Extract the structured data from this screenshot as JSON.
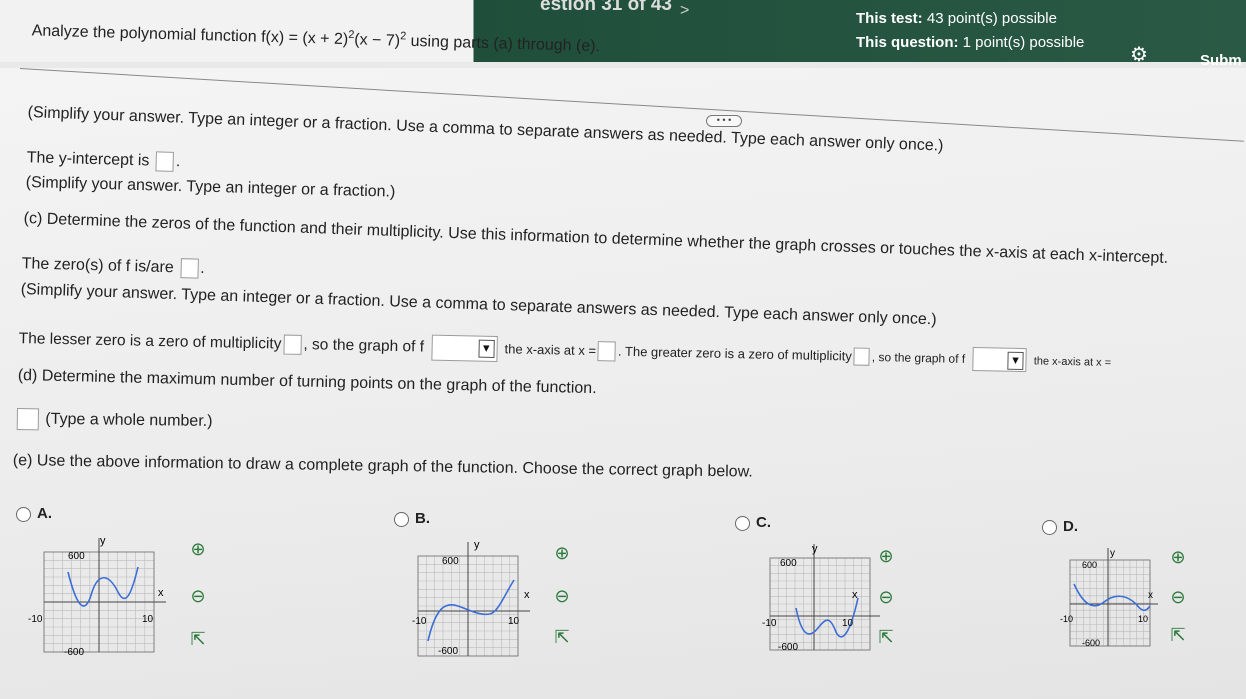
{
  "header": {
    "question_counter": "estion 31 of 43",
    "next_arrow": ">",
    "test_points_label": "This test:",
    "test_points_value": "43 point(s) possible",
    "question_points_label": "This question:",
    "question_points_value": "1 point(s) possible",
    "submit_label": "Subm"
  },
  "problem": {
    "prefix": "Analyze the polynomial function f(x) = (x + 2)",
    "exp1": "2",
    "mid": "(x − 7)",
    "exp2": "2",
    "suffix": " using parts (a) through (e)."
  },
  "more_button": "• • •",
  "lines": {
    "b_simplify": "(Simplify your answer. Type an integer or a fraction. Use a comma to separate answers as needed. Type each answer only once.)",
    "y_intercept_label": "The y-intercept is",
    "y_intercept_end": ".",
    "b_simplify2": "(Simplify your answer. Type an integer or a fraction.)",
    "c_prompt": "(c) Determine the zeros of the function and their multiplicity. Use this information to determine whether the graph crosses or touches the x-axis at each x-intercept.",
    "zeros_label": "The zero(s) of f is/are",
    "zeros_end": ".",
    "c_simplify": "(Simplify your answer. Type an integer or a fraction. Use a comma to separate answers as needed. Type each answer only once.)",
    "lesser_a": "The lesser zero is a zero of multiplicity",
    "lesser_b": ", so the graph of f",
    "lesser_c": "the x-axis at x =",
    "greater_a": ". The greater zero is a zero of multiplicity",
    "greater_b": ", so the graph of f",
    "greater_c": "the x-axis at x =",
    "d_prompt": "(d) Determine the maximum number of turning points on the graph of the function.",
    "d_hint": "(Type a whole number.)",
    "e_prompt": "(e) Use the above information to draw a complete graph of the function. Choose the correct graph below."
  },
  "options": [
    {
      "label": "A.",
      "ymax": "600",
      "ymin": "-600",
      "xmin": "-10",
      "xmax": "10",
      "xlab": "x",
      "ylab": "y"
    },
    {
      "label": "B.",
      "ymax": "600",
      "ymin": "-600",
      "xmin": "-10",
      "xmax": "10",
      "xlab": "x",
      "ylab": "y"
    },
    {
      "label": "C.",
      "ymax": "600",
      "ymin": "-600",
      "xmin": "-10",
      "xmax": "10",
      "xlab": "x",
      "ylab": "y"
    },
    {
      "label": "D.",
      "ymax": "600",
      "ymin": "-600",
      "xmin": "-10",
      "xmax": "10",
      "xlab": "x",
      "ylab": "y"
    }
  ],
  "icons": {
    "zoom_in": "zoom-in-icon",
    "zoom_out": "zoom-out-icon",
    "popout": "popout-icon",
    "settings": "gear-icon"
  },
  "colors": {
    "header_green": "#1f4f3a",
    "curve_blue": "#3b6fd6",
    "icon_green": "#2c7a3c"
  }
}
